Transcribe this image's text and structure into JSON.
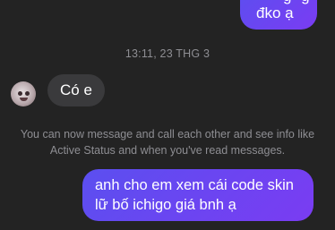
{
  "conversation": {
    "previous_message": {
      "text": "đko ạ",
      "clipped_tail": "g g"
    },
    "timestamp": "13:11, 23 THG 3",
    "incoming_message": {
      "text": "Có e"
    },
    "system_note": "You can now message and call each other and see info like Active Status and when you've read messages.",
    "outgoing_message": {
      "line1": "anh cho em xem cái code skin",
      "line2": "lữ bố ichigo giá bnh ạ"
    }
  },
  "colors": {
    "background": "#232323",
    "outgoing_bubble_start": "#5b4ff0",
    "outgoing_bubble_end": "#7a3cf2",
    "incoming_bubble": "#3a3a3c",
    "meta_text": "#8e8e93"
  }
}
